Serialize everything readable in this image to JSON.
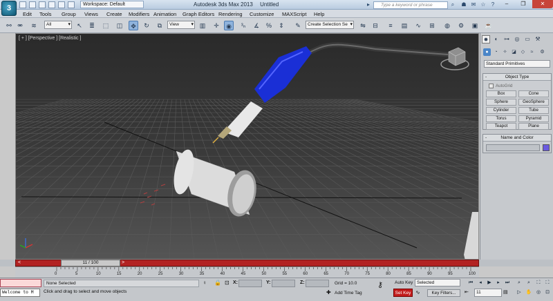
{
  "titlebar": {
    "app_logo": "3",
    "workspace_label": "Workspace: Default",
    "title": "Autodesk 3ds Max 2013",
    "document": "Untitled",
    "search_placeholder": "Type a keyword or phrase"
  },
  "menu": [
    "Edit",
    "Tools",
    "Group",
    "Views",
    "Create",
    "Modifiers",
    "Animation",
    "Graph Editors",
    "Rendering",
    "Customize",
    "MAXScript",
    "Help"
  ],
  "toolbar": {
    "selection_filter": "All",
    "reference_coord": "View",
    "named_selection": "Create Selection Se"
  },
  "viewport": {
    "label": "[ + ] [Perspective ] [Realistic ]",
    "colors": {
      "handle": "#1a2fd6",
      "pipe": "#e0e0e0",
      "grid": "#6c6c6c"
    }
  },
  "command_panel": {
    "primitive_type": "Standard Primitives",
    "object_type_title": "Object Type",
    "autogrid": "AutoGrid",
    "buttons": [
      "Box",
      "Cone",
      "Sphere",
      "GeoSphere",
      "Cylinder",
      "Tube",
      "Torus",
      "Pyramid",
      "Teapot",
      "Plane"
    ],
    "name_color_title": "Name and Color",
    "object_color": "#6a5ae0"
  },
  "timeline": {
    "current": "11 / 100",
    "ticks": [
      "0",
      "5",
      "10",
      "15",
      "20",
      "25",
      "30",
      "35",
      "40",
      "45",
      "50",
      "55",
      "60",
      "65",
      "70",
      "75",
      "80",
      "85",
      "90",
      "95",
      "100"
    ]
  },
  "status": {
    "maxscript": "Welcome to M",
    "selection": "None Selected",
    "prompt": "Click and drag to select and move objects",
    "x_label": "X:",
    "y_label": "Y:",
    "z_label": "Z:",
    "grid": "Grid = 10.0",
    "add_time_tag": "Add Time Tag",
    "auto_key": "Auto Key",
    "key_mode": "Selected",
    "set_key": "Set Key",
    "key_filters": "Key Filters...",
    "frame": "11"
  }
}
